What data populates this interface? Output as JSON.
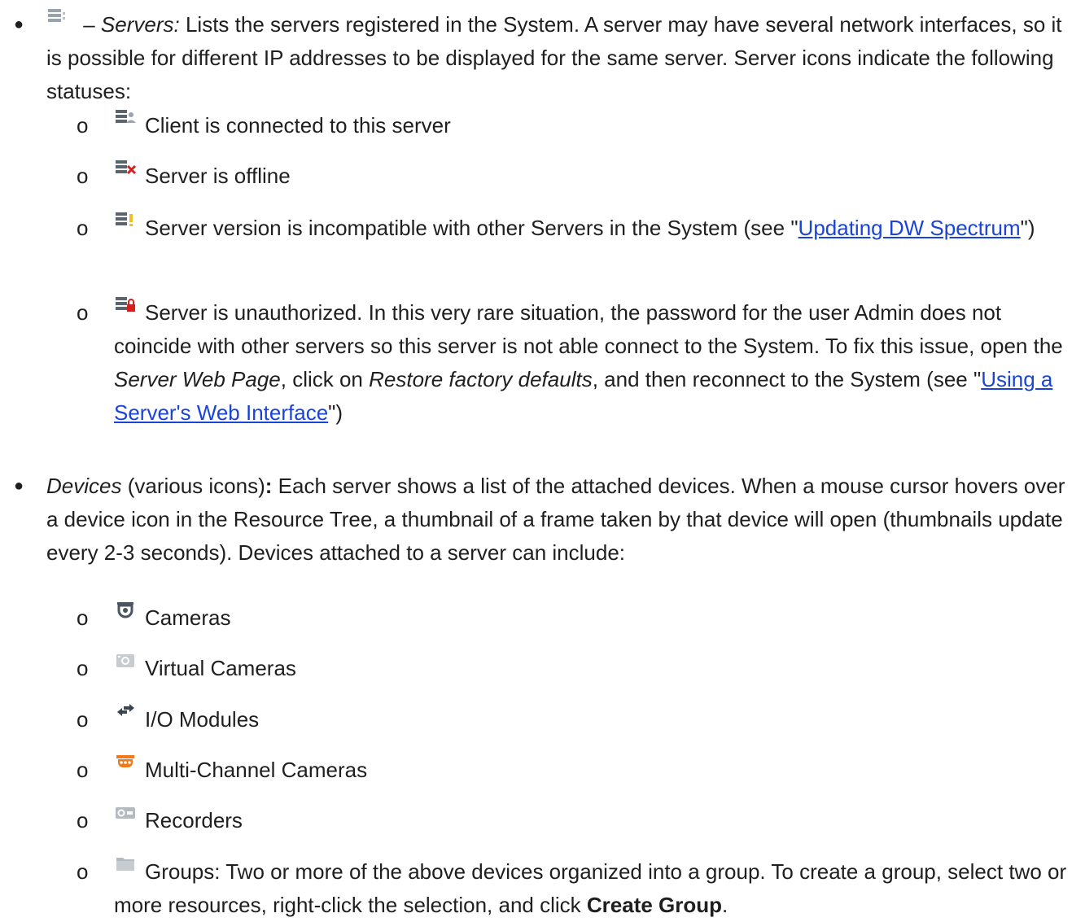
{
  "servers": {
    "dash": " – ",
    "title": "Servers:",
    "desc": " Lists the servers registered in the System. A server may have several network interfaces, so it is possible for different IP addresses to be displayed for the same server. Server icons indicate the following statuses:",
    "statuses": [
      {
        "icon": "server-connected-icon",
        "text": "Client is connected to this server"
      },
      {
        "icon": "server-offline-icon",
        "text": "Server is offline"
      },
      {
        "icon": "server-incompatible-icon",
        "text_before": "Server version is incompatible with other Servers in the System (see \"",
        "link": "Updating DW Spectrum",
        "text_after": "\")"
      },
      {
        "icon": "server-unauthorized-icon",
        "text_1": "Server is unauthorized. In this very rare situation, the password for the user Admin does not coincide with other servers so this server is not able connect to the System. To fix this issue, open the ",
        "em_1": "Server Web Page",
        "text_2": ", click on ",
        "em_2": "Restore factory defaults",
        "text_3": ", and then reconnect to the System (see \"",
        "link": "Using a Server's Web Interface",
        "text_4": "\")"
      }
    ]
  },
  "devices": {
    "title": "Devices",
    "title_suffix": " (various icons)",
    "colon": ":",
    "desc": " Each server shows a list of the attached devices. When a mouse cursor hovers over a device icon in the Resource Tree, a thumbnail of a frame taken by that device will open (thumbnails update every 2-3 seconds). Devices attached to a server can include:",
    "types": [
      {
        "icon": "camera-icon",
        "label": "Cameras"
      },
      {
        "icon": "virtual-camera-icon",
        "label": "Virtual Cameras"
      },
      {
        "icon": "io-module-icon",
        "label": "I/O Modules"
      },
      {
        "icon": "multichannel-camera-icon",
        "label": "Multi-Channel Cameras"
      },
      {
        "icon": "recorder-icon",
        "label": "Recorders"
      }
    ],
    "groups": {
      "icon": "folder-icon",
      "text": "Groups: Two or more of the above devices organized into a group. To create a group, select two or more resources, right-click the selection, and click ",
      "bold": "Create Group",
      "end": "."
    }
  },
  "colors": {
    "link": "#1a44d8",
    "text": "#1f1f1f",
    "multichannel": "#f07a1a",
    "offline_x": "#d32020",
    "warn": "#f0c020",
    "lock": "#d32020"
  }
}
